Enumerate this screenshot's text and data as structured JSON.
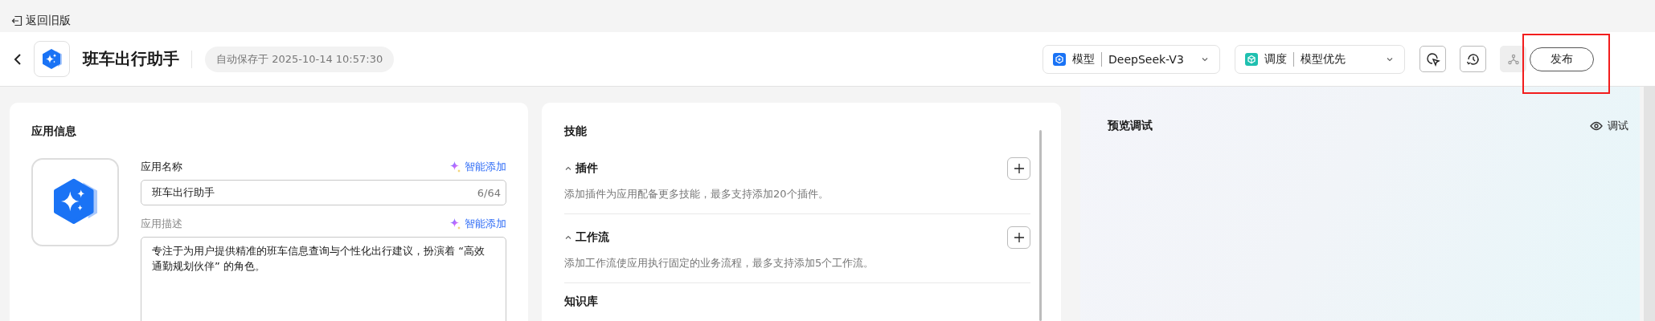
{
  "back_link": {
    "label": "返回旧版"
  },
  "header": {
    "title": "班车出行助手",
    "autosave": "自动保存于 2025-10-14 10:57:30",
    "selectors": [
      {
        "kind": "model",
        "label": "模型",
        "value": "DeepSeek-V3"
      },
      {
        "kind": "schedule",
        "label": "调度",
        "value": "模型优先"
      }
    ],
    "tools": [
      {
        "kind": "cursor",
        "disabled": false
      },
      {
        "kind": "history",
        "disabled": false
      },
      {
        "kind": "network",
        "disabled": true
      }
    ],
    "publish": {
      "label": "发布",
      "highlighted": true
    }
  },
  "app_info": {
    "title": "应用信息",
    "fields": [
      {
        "kind": "input",
        "label": "应用名称",
        "active": true,
        "action": "智能添加",
        "value": "班车出行助手",
        "count": "6/64"
      },
      {
        "kind": "textarea",
        "label": "应用描述",
        "active": false,
        "action": "智能添加",
        "value": "专注于为用户提供精准的班车信息查询与个性化出行建议，扮演着 “高效通勤规划伙伴” 的角色。"
      }
    ]
  },
  "skills": {
    "title": "技能",
    "sections": [
      {
        "title": "插件",
        "expanded": true,
        "description": "添加插件为应用配备更多技能，最多支持添加20个插件。"
      },
      {
        "title": "工作流",
        "expanded": true,
        "description": "添加工作流使应用执行固定的业务流程，最多支持添加5个工作流。"
      }
    ],
    "next_section": "知识库"
  },
  "preview": {
    "title": "预览调试",
    "action": "调试"
  }
}
